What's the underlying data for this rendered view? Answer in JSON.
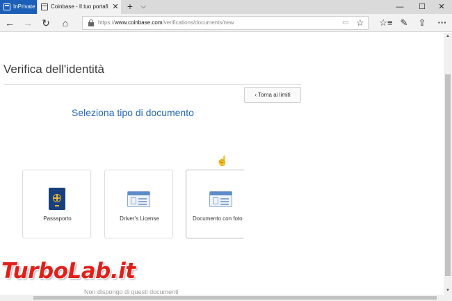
{
  "browser": {
    "inprivate_label": "InPrivate",
    "tab_title": "Coinbase - Il tuo portafi",
    "tab_close": "✕",
    "new_tab": "+",
    "tab_list": "⌵",
    "window": {
      "minimize": "—",
      "maximize": "☐",
      "close": "✕"
    },
    "nav": {
      "back": "←",
      "forward": "→",
      "refresh": "↻",
      "home": "⌂"
    },
    "url_scheme": "https://",
    "url_domain": "www.coinbase.com",
    "url_path": "/verifications/documents/new",
    "toolbar": {
      "reading_view": "▭",
      "favorite": "☆",
      "favorites_hub": "☆≡",
      "notes": "✎",
      "share": "⇪",
      "more": "···"
    }
  },
  "page": {
    "title": "Verifica dell'identità",
    "back_button_chevron": "‹",
    "back_button_label": "Torna ai limiti",
    "heading": "Seleziona tipo di documento",
    "documents": [
      {
        "label": "Passaporto",
        "icon": "passport-icon"
      },
      {
        "label": "Driver's License",
        "icon": "id-card-icon"
      },
      {
        "label": "Documento con foto",
        "icon": "id-card-icon"
      }
    ],
    "no_documents_link": "Non dispongo di questi documenti",
    "cursor": "☝"
  },
  "watermark": "TurboLab.it",
  "scrollbar": {
    "up": "▲",
    "down": "▼"
  },
  "colors": {
    "inprivate": "#1c5fb8",
    "heading": "#2568b5",
    "passport": "#17407c",
    "accent": "#e9b73a",
    "watermark": "#e0201b"
  }
}
